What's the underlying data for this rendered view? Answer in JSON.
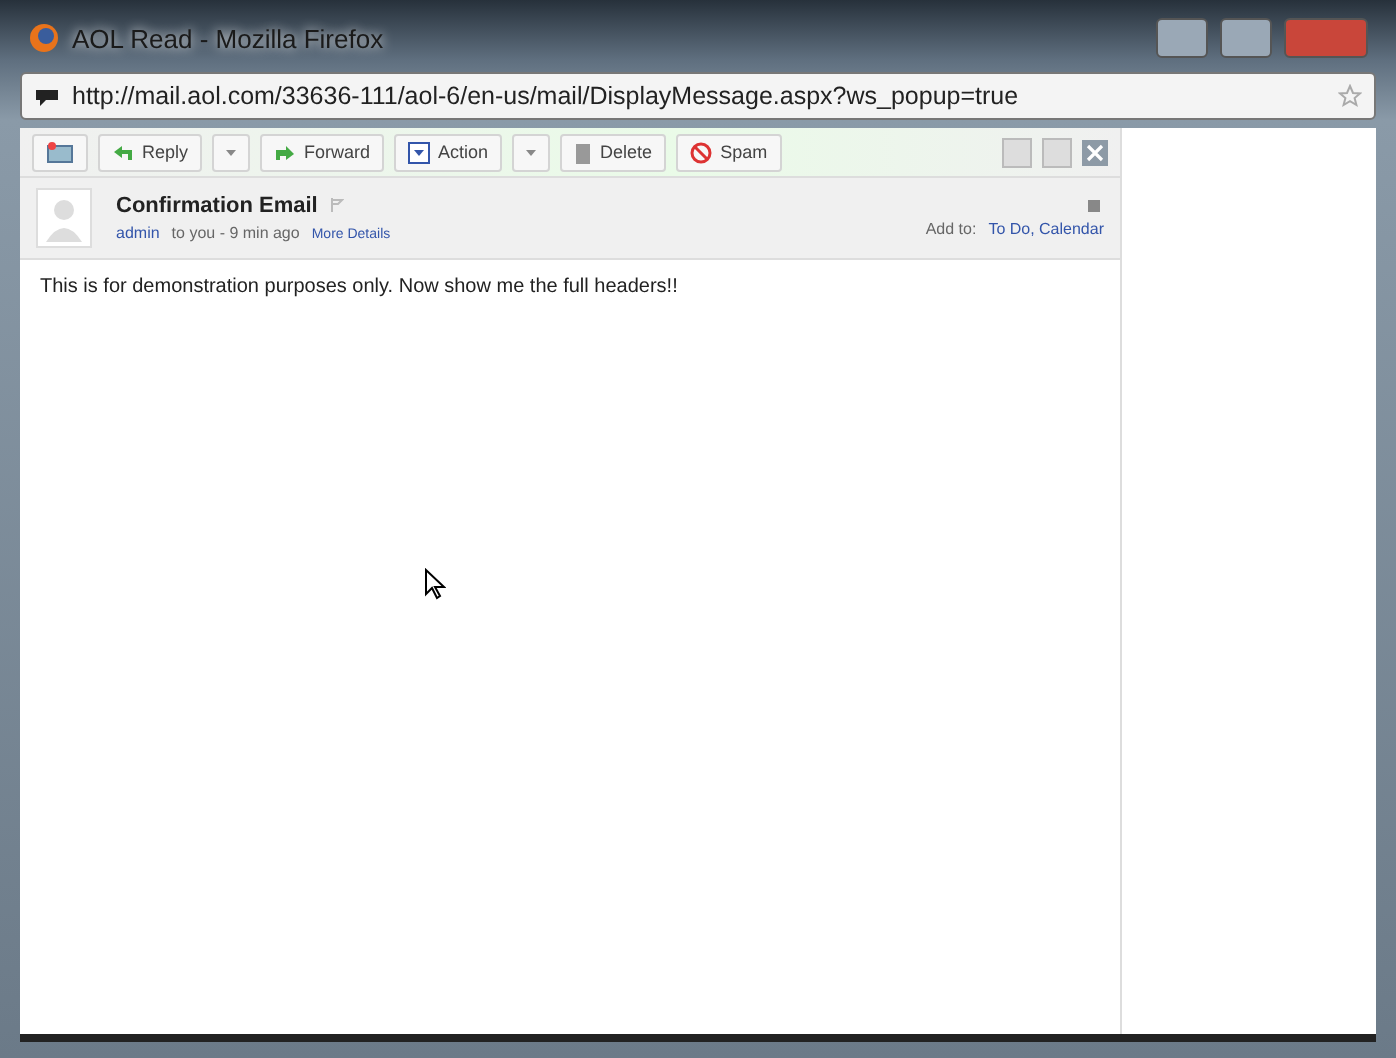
{
  "window": {
    "title": "AOL Read - Mozilla Firefox"
  },
  "address_bar": {
    "url": "http://mail.aol.com/33636-111/aol-6/en-us/mail/DisplayMessage.aspx?ws_popup=true"
  },
  "toolbar": [
    {
      "kind": "compose"
    },
    {
      "kind": "reply",
      "label": "Reply"
    },
    {
      "kind": "dropdown"
    },
    {
      "kind": "forward",
      "label": "Forward"
    },
    {
      "kind": "action",
      "label": "Action"
    },
    {
      "kind": "dropdown"
    },
    {
      "kind": "delete",
      "label": "Delete"
    },
    {
      "kind": "spam",
      "label": "Spam"
    }
  ],
  "message": {
    "subject": "Confirmation Email",
    "sender": "admin",
    "meta": "to you - 9 min ago",
    "more_details": "More Details",
    "add_to_label": "Add to:",
    "add_to_links": "To Do, Calendar",
    "body": "This is for demonstration purposes only. Now show me the full headers!!"
  }
}
